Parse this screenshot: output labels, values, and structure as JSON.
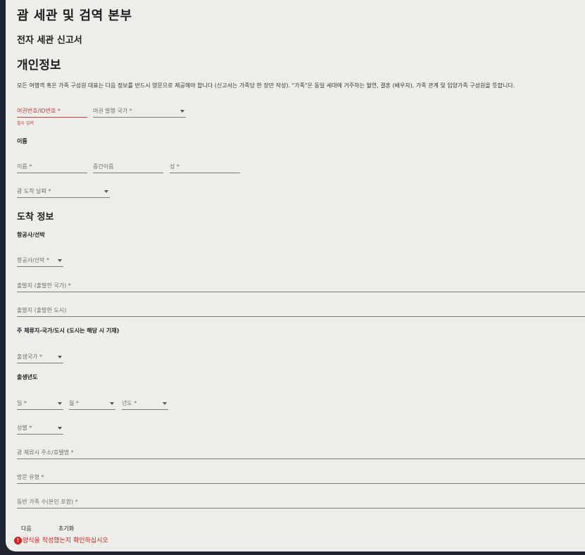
{
  "header": {
    "agency": "괌 세관 및 검역 본부",
    "form_title": "전자 세관 신고서"
  },
  "personal": {
    "heading": "개인정보",
    "description": "모든 여행객 혹은 가족 구성원 대표는 다음 정보를 반드시 영문으로 제공해야 합니다 (신고서는 가족당 한 장만 작성). \"가족\"은 동일 세대에 거주하는 혈연, 결혼 (배우자), 가족 관계 및 입양가족 구성원을 뜻합니다.",
    "passport_no": "여권번호/ID번호 *",
    "passport_required": "필수 입력",
    "passport_country": "여권 발행 국가 *",
    "name_label": "이름",
    "first_name": "이름 *",
    "middle_name": "중간이름",
    "last_name": "성 *",
    "arrival_date": "괌 도착 날짜 *"
  },
  "arrival": {
    "heading": "도착 정보",
    "airline_label": "항공사/선박",
    "airline_select": "항공사/선박 *",
    "departure_country": "출발지 (출발한 국가) *",
    "departure_city": "출발지 (출발한 도시)",
    "residence_label": "주 체류지-국가/도시 (도시는 해당 시 기재)",
    "birth_country": "출생국가 *",
    "birth_year_label": "출생년도",
    "day": "일 *",
    "month": "월 *",
    "year": "년도 *",
    "gender": "성별 *",
    "guam_address": "괌 체류시 주소/호텔명 *",
    "visit_type": "방문 유형 *",
    "family_count": "동반 가족 수(본인 포함) *"
  },
  "actions": {
    "next": "다음",
    "reset": "초기화",
    "warning": "양식을 작성했는지 확인하십시오"
  }
}
